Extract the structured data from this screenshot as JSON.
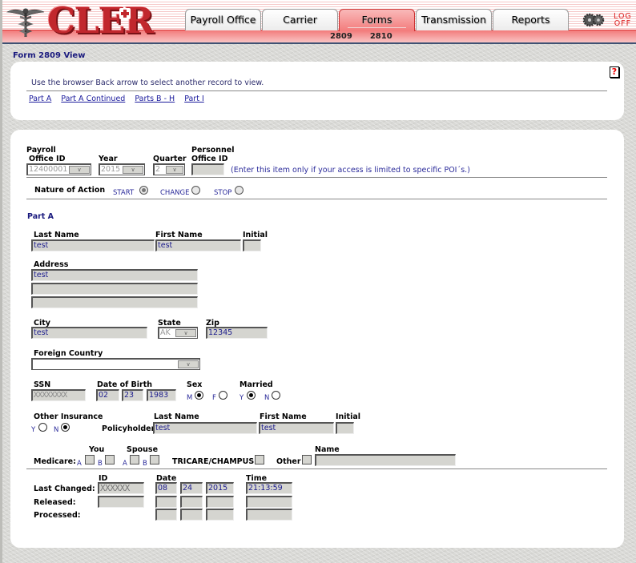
{
  "header": {
    "logo_text": "CLER",
    "tabs": [
      {
        "label": "Payroll Office",
        "active": false
      },
      {
        "label": "Carrier",
        "active": false
      },
      {
        "label": "Forms",
        "active": true
      },
      {
        "label": "Transmission",
        "active": false
      },
      {
        "label": "Reports",
        "active": false
      }
    ],
    "subtabs": [
      "2809",
      "2810"
    ],
    "logoff": {
      "line1": "LOG",
      "line2": "OFF"
    }
  },
  "page_title": "Form 2809 View",
  "help_icon": "?",
  "instructions": "Use the browser Back arrow to select another record to view.",
  "section_links": [
    "Part A",
    "Part A Continued",
    "Parts B - H",
    "Part I"
  ],
  "top_fields": {
    "payroll_office_label1": "Payroll",
    "payroll_office_label2": "Office ID",
    "payroll_office_value": "12400001",
    "year_label": "Year",
    "year_value": "2015",
    "quarter_label": "Quarter",
    "quarter_value": "2",
    "personnel_label1": "Personnel",
    "personnel_label2": "Office ID",
    "personnel_value": "",
    "personnel_note": "(Enter this item only if your access is limited to specific POI´s.)"
  },
  "nature_of_action": {
    "label": "Nature of Action",
    "options": [
      {
        "label": "START",
        "checked": true
      },
      {
        "label": "CHANGE",
        "checked": false
      },
      {
        "label": "STOP",
        "checked": false
      }
    ]
  },
  "part_a": {
    "heading": "Part A",
    "last_name_label": "Last Name",
    "last_name": "test",
    "first_name_label": "First Name",
    "first_name": "test",
    "initial_label": "Initial",
    "initial": "",
    "address_label": "Address",
    "address": [
      "test",
      "",
      ""
    ],
    "city_label": "City",
    "city": "test",
    "state_label": "State",
    "state": "AK",
    "zip_label": "Zip",
    "zip": "12345",
    "foreign_country_label": "Foreign Country",
    "foreign_country": "",
    "ssn_label": "SSN",
    "ssn": "XXXXXXXX",
    "dob_label": "Date of Birth",
    "dob_month": "02",
    "dob_day": "23",
    "dob_year": "1983",
    "sex_label": "Sex",
    "sex_m": "M",
    "sex_f": "F",
    "sex_value": "M",
    "married_label": "Married",
    "married_y": "Y",
    "married_n": "N",
    "married_value": "Y",
    "other_insurance_label": "Other Insurance",
    "oi_y": "Y",
    "oi_n": "N",
    "other_insurance_value": "N",
    "policyholder_label": "Policyholder",
    "ph_last_name_label": "Last Name",
    "ph_last_name": "test",
    "ph_first_name_label": "First Name",
    "ph_first_name": "test",
    "ph_initial_label": "Initial",
    "ph_initial": "",
    "medicare_label": "Medicare:",
    "you_label": "You",
    "spouse_label": "Spouse",
    "a_label": "A",
    "b_label": "B",
    "tricare_label": "TRICARE/CHAMPUS",
    "other_label": "Other",
    "name_label": "Name",
    "other_name": ""
  },
  "audit": {
    "id_label": "ID",
    "date_label": "Date",
    "time_label": "Time",
    "rows": [
      {
        "label": "Last Changed:",
        "id": "XXXXXX",
        "month": "08",
        "day": "24",
        "year": "2015",
        "time": "21:13:59"
      },
      {
        "label": "Released:",
        "id": "",
        "month": "",
        "day": "",
        "year": "",
        "time": ""
      },
      {
        "label": "Processed:",
        "month": "",
        "day": "",
        "year": "",
        "time": ""
      }
    ]
  },
  "colors": {
    "brand_red": "#c1272d",
    "link_blue": "#1a1a9c",
    "title_navy": "#1a1a7e"
  }
}
